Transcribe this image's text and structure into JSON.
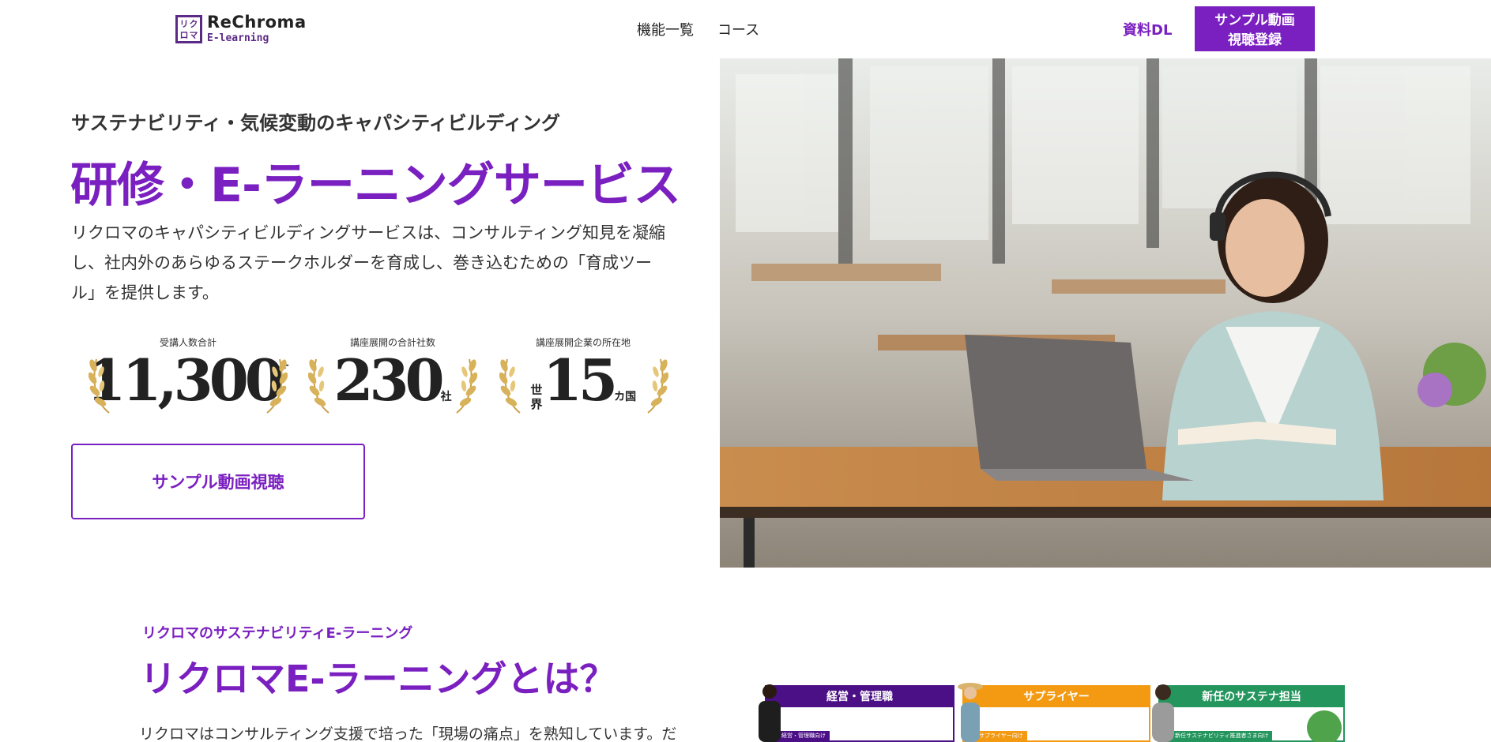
{
  "header": {
    "logo_title": "ReChroma",
    "logo_sub": "E-learning",
    "logo_mark": [
      "リ",
      "ク",
      "ロ",
      "マ"
    ],
    "nav": [
      {
        "label": "機能一覧"
      },
      {
        "label": "コース"
      }
    ],
    "doc_download": "資料DL",
    "cta_line1": "サンプル動画",
    "cta_line2": "視聴登録"
  },
  "hero": {
    "subtitle": "サステナビリティ・気候変動のキャパシティビルディング",
    "title": "研修・E-ラーニングサービス",
    "body": "リクロマのキャパシティビルディングサービスは、コンサルティング知見を凝縮し、社内外のあらゆるステークホルダーを育成し、巻き込むための「育成ツール」を提供します。",
    "stats": [
      {
        "label": "受講人数合計",
        "prefix": "",
        "value": "11,300",
        "unit": "+"
      },
      {
        "label": "講座展開の合計社数",
        "prefix": "",
        "value": "230",
        "unit": "社"
      },
      {
        "label": "講座展開企業の所在地",
        "prefix": "世界",
        "value": "15",
        "unit": "カ国"
      }
    ],
    "sample_button": "サンプル動画視聴"
  },
  "section_about": {
    "subtitle": "リクロマのサステナビリティE-ラーニング",
    "title": "リクロマE-ラーニングとは？",
    "body": "リクロマはコンサルティング支援で培った「現場の痛点」を熟知しています。だ",
    "cards": [
      {
        "title": "経営・管理職",
        "tag": "経営・管理職向け",
        "color": "#4b0f86"
      },
      {
        "title": "サプライヤー",
        "tag": "サプライヤー向け",
        "color": "#f39a12"
      },
      {
        "title": "新任のサステナ担当",
        "tag": "新任サステナビリティ推進者さま向け",
        "color": "#23955d"
      }
    ]
  },
  "colors": {
    "accent": "#7a1fc0",
    "text": "#333333"
  }
}
